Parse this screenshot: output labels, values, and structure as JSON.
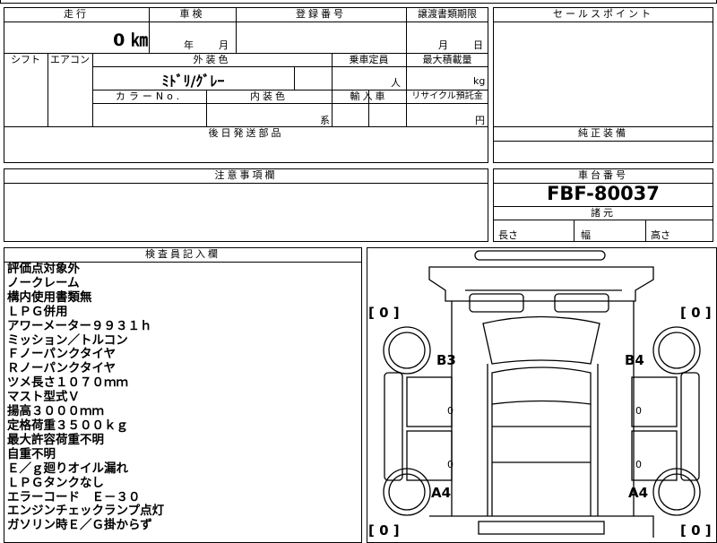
{
  "vehicle_info": {
    "mileage": {
      "header": "走行",
      "value": "0 ㎞"
    },
    "inspection": {
      "header": "車検",
      "year_unit": "年",
      "month_unit": "月"
    },
    "registration": {
      "header": "登録番号"
    },
    "transfer_deadline": {
      "header": "譲渡書類期限",
      "month_unit": "月",
      "day_unit": "日"
    },
    "shift": {
      "header": "シフト"
    },
    "aircon": {
      "header": "エアコン"
    },
    "exterior_color": {
      "header": "外装色",
      "value": "ﾐﾄﾞﾘ/ｸﾞﾚｰ"
    },
    "capacity": {
      "header": "乗車定員",
      "unit": "人"
    },
    "max_load": {
      "header": "最大積載量",
      "unit": "kg"
    },
    "color_no": {
      "header": "カラーNo."
    },
    "interior_color": {
      "header": "内装色",
      "unit": "系"
    },
    "import": {
      "header": "輸入車"
    },
    "recycle": {
      "header": "リサイクル預託金",
      "unit": "円"
    },
    "later_parts": {
      "header": "後日発送部品"
    }
  },
  "sales_point": {
    "header": "セールスポイント"
  },
  "genuine_equipment": {
    "header": "純正装備"
  },
  "caution": {
    "header": "注意事項欄"
  },
  "chassis": {
    "header": "車台番号",
    "number": "FBF-80037",
    "specs_header": "諸元",
    "length_label": "長さ",
    "width_label": "幅",
    "height_label": "高さ"
  },
  "inspector": {
    "header": "検査員記入欄",
    "notes": [
      "評価点対象外",
      "ノークレーム",
      "構内使用書類無",
      "ＬＰＧ併用",
      "アワーメーター９９３１ｈ",
      "ミッション／トルコン",
      "Ｆノーパンクタイヤ",
      "Ｒノーパンクタイヤ",
      "ツメ長さ１０７０ｍｍ",
      "マスト型式Ｖ",
      "揚高３０００ｍｍ",
      "定格荷重３５００ｋｇ",
      "最大許容荷重不明",
      "自重不明",
      "Ｅ／ｇ廻りオイル漏れ",
      "ＬＰＧタンクなし",
      "エラーコード　Ｅ－３０",
      "エンジンチェックランプ点灯",
      "ガソリン時Ｅ／Ｇ掛からず"
    ]
  },
  "diagram": {
    "tire_top_left": "[ 0 ]",
    "tire_top_right": "[ 0 ]",
    "tire_bottom_left": "[ 0 ]",
    "tire_bottom_right": "[ 0 ]",
    "mark_rear_left": "B3",
    "mark_rear_right": "B4",
    "mark_front_left": "A4",
    "mark_front_right": "A4",
    "side_value": "0"
  }
}
